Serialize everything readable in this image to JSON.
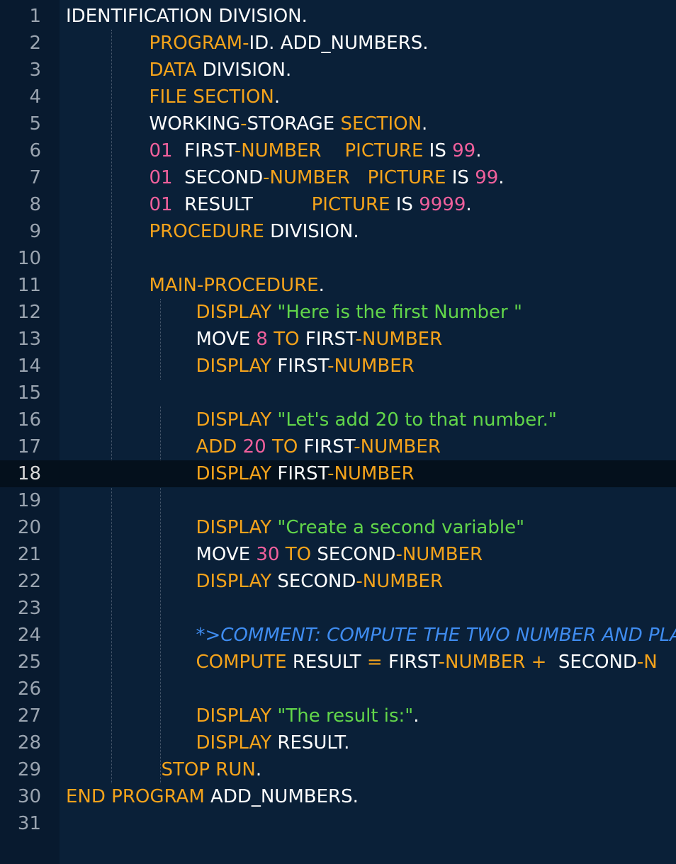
{
  "editor": {
    "language": "COBOL",
    "active_line": 18,
    "colors": {
      "background": "#0a2038",
      "gutter": "#081a2f",
      "active_line": "#04101c",
      "keyword": "#f5a31b",
      "number": "#f0609c",
      "string": "#62d64a",
      "comment": "#3f8cf0",
      "text": "#ffffff",
      "line_number": "#9aa4b0"
    },
    "lines": [
      {
        "n": "1",
        "indent": 0,
        "tokens": [
          {
            "t": "IDENTIFICATION DIVISION.",
            "c": "txt"
          }
        ]
      },
      {
        "n": "2",
        "indent": 1,
        "tokens": [
          {
            "t": "PROGRAM",
            "c": "kw"
          },
          {
            "t": "-",
            "c": "kw"
          },
          {
            "t": "ID. ADD_NUMBERS.",
            "c": "txt"
          }
        ]
      },
      {
        "n": "3",
        "indent": 1,
        "tokens": [
          {
            "t": "DATA",
            "c": "kw"
          },
          {
            "t": " DIVISION.",
            "c": "txt"
          }
        ]
      },
      {
        "n": "4",
        "indent": 1,
        "tokens": [
          {
            "t": "FILE",
            "c": "kw"
          },
          {
            "t": " ",
            "c": "txt"
          },
          {
            "t": "SECTION",
            "c": "kw"
          },
          {
            "t": ".",
            "c": "txt"
          }
        ]
      },
      {
        "n": "5",
        "indent": 1,
        "tokens": [
          {
            "t": "WORKING",
            "c": "txt"
          },
          {
            "t": "-",
            "c": "kw"
          },
          {
            "t": "STORAGE ",
            "c": "txt"
          },
          {
            "t": "SECTION",
            "c": "kw"
          },
          {
            "t": ".",
            "c": "txt"
          }
        ]
      },
      {
        "n": "6",
        "indent": 1,
        "tokens": [
          {
            "t": "01",
            "c": "num"
          },
          {
            "t": "  FIRST",
            "c": "txt"
          },
          {
            "t": "-NUMBER",
            "c": "kw"
          },
          {
            "t": "    ",
            "c": "txt"
          },
          {
            "t": "PICTURE",
            "c": "kw"
          },
          {
            "t": " IS ",
            "c": "txt"
          },
          {
            "t": "99",
            "c": "num"
          },
          {
            "t": ".",
            "c": "txt"
          }
        ]
      },
      {
        "n": "7",
        "indent": 1,
        "tokens": [
          {
            "t": "01",
            "c": "num"
          },
          {
            "t": "  SECOND",
            "c": "txt"
          },
          {
            "t": "-NUMBER",
            "c": "kw"
          },
          {
            "t": "   ",
            "c": "txt"
          },
          {
            "t": "PICTURE",
            "c": "kw"
          },
          {
            "t": " IS ",
            "c": "txt"
          },
          {
            "t": "99",
            "c": "num"
          },
          {
            "t": ".",
            "c": "txt"
          }
        ]
      },
      {
        "n": "8",
        "indent": 1,
        "tokens": [
          {
            "t": "01",
            "c": "num"
          },
          {
            "t": "  RESULT          ",
            "c": "txt"
          },
          {
            "t": "PICTURE",
            "c": "kw"
          },
          {
            "t": " IS ",
            "c": "txt"
          },
          {
            "t": "9999",
            "c": "num"
          },
          {
            "t": ".",
            "c": "txt"
          }
        ]
      },
      {
        "n": "9",
        "indent": 1,
        "tokens": [
          {
            "t": "PROCEDURE",
            "c": "kw"
          },
          {
            "t": " DIVISION.",
            "c": "txt"
          }
        ]
      },
      {
        "n": "10",
        "indent": 1,
        "tokens": []
      },
      {
        "n": "11",
        "indent": 1,
        "tokens": [
          {
            "t": "MAIN",
            "c": "kw"
          },
          {
            "t": "-",
            "c": "kw"
          },
          {
            "t": "PROCEDURE",
            "c": "kw"
          },
          {
            "t": ".",
            "c": "txt"
          }
        ]
      },
      {
        "n": "12",
        "indent": 2,
        "tokens": [
          {
            "t": "DISPLAY",
            "c": "kw"
          },
          {
            "t": " ",
            "c": "txt"
          },
          {
            "t": "\"Here is the first Number \"",
            "c": "str"
          }
        ]
      },
      {
        "n": "13",
        "indent": 2,
        "tokens": [
          {
            "t": "MOVE ",
            "c": "txt"
          },
          {
            "t": "8",
            "c": "num"
          },
          {
            "t": " ",
            "c": "txt"
          },
          {
            "t": "TO",
            "c": "kw"
          },
          {
            "t": " FIRST",
            "c": "txt"
          },
          {
            "t": "-NUMBER",
            "c": "kw"
          }
        ]
      },
      {
        "n": "14",
        "indent": 2,
        "tokens": [
          {
            "t": "DISPLAY",
            "c": "kw"
          },
          {
            "t": " FIRST",
            "c": "txt"
          },
          {
            "t": "-NUMBER",
            "c": "kw"
          }
        ]
      },
      {
        "n": "15",
        "indent": 2,
        "tokens": []
      },
      {
        "n": "16",
        "indent": 2,
        "tokens": [
          {
            "t": "DISPLAY",
            "c": "kw"
          },
          {
            "t": " ",
            "c": "txt"
          },
          {
            "t": "\"Let's add 20 to that number.\"",
            "c": "str"
          }
        ]
      },
      {
        "n": "17",
        "indent": 2,
        "tokens": [
          {
            "t": "ADD",
            "c": "kw"
          },
          {
            "t": " ",
            "c": "txt"
          },
          {
            "t": "20",
            "c": "num"
          },
          {
            "t": " ",
            "c": "txt"
          },
          {
            "t": "TO",
            "c": "kw"
          },
          {
            "t": " FIRST",
            "c": "txt"
          },
          {
            "t": "-NUMBER",
            "c": "kw"
          }
        ]
      },
      {
        "n": "18",
        "indent": 2,
        "tokens": [
          {
            "t": "DISPLAY",
            "c": "kw"
          },
          {
            "t": " FIRST",
            "c": "txt"
          },
          {
            "t": "-NUMBER",
            "c": "kw"
          }
        ]
      },
      {
        "n": "19",
        "indent": 2,
        "tokens": []
      },
      {
        "n": "20",
        "indent": 2,
        "tokens": [
          {
            "t": "DISPLAY",
            "c": "kw"
          },
          {
            "t": " ",
            "c": "txt"
          },
          {
            "t": "\"Create a second variable\"",
            "c": "str"
          }
        ]
      },
      {
        "n": "21",
        "indent": 2,
        "tokens": [
          {
            "t": "MOVE ",
            "c": "txt"
          },
          {
            "t": "30",
            "c": "num"
          },
          {
            "t": " ",
            "c": "txt"
          },
          {
            "t": "TO",
            "c": "kw"
          },
          {
            "t": " SECOND",
            "c": "txt"
          },
          {
            "t": "-NUMBER",
            "c": "kw"
          }
        ]
      },
      {
        "n": "22",
        "indent": 2,
        "tokens": [
          {
            "t": "DISPLAY",
            "c": "kw"
          },
          {
            "t": " SECOND",
            "c": "txt"
          },
          {
            "t": "-NUMBER",
            "c": "kw"
          }
        ]
      },
      {
        "n": "23",
        "indent": 2,
        "tokens": []
      },
      {
        "n": "24",
        "indent": 2,
        "tokens": [
          {
            "t": "*>COMMENT: COMPUTE THE TWO NUMBER AND PLA",
            "c": "cmt"
          }
        ]
      },
      {
        "n": "25",
        "indent": 2,
        "tokens": [
          {
            "t": "COMPUTE",
            "c": "kw"
          },
          {
            "t": " RESULT ",
            "c": "txt"
          },
          {
            "t": "=",
            "c": "kw"
          },
          {
            "t": " FIRST",
            "c": "txt"
          },
          {
            "t": "-NUMBER",
            "c": "kw"
          },
          {
            "t": " ",
            "c": "txt"
          },
          {
            "t": "+",
            "c": "kw"
          },
          {
            "t": "  SECOND",
            "c": "txt"
          },
          {
            "t": "-N",
            "c": "kw"
          }
        ]
      },
      {
        "n": "26",
        "indent": 2,
        "tokens": []
      },
      {
        "n": "27",
        "indent": 2,
        "tokens": [
          {
            "t": "DISPLAY",
            "c": "kw"
          },
          {
            "t": " ",
            "c": "txt"
          },
          {
            "t": "\"The result is:\"",
            "c": "str"
          },
          {
            "t": ".",
            "c": "txt"
          }
        ]
      },
      {
        "n": "28",
        "indent": 2,
        "tokens": [
          {
            "t": "DISPLAY",
            "c": "kw"
          },
          {
            "t": " RESULT.",
            "c": "txt"
          }
        ]
      },
      {
        "n": "29",
        "indent": 1.25,
        "tokens": [
          {
            "t": "STOP",
            "c": "kw"
          },
          {
            "t": " ",
            "c": "txt"
          },
          {
            "t": "RUN",
            "c": "kw"
          },
          {
            "t": ".",
            "c": "txt"
          }
        ]
      },
      {
        "n": "30",
        "indent": 0,
        "tokens": [
          {
            "t": "END",
            "c": "kw"
          },
          {
            "t": " ",
            "c": "txt"
          },
          {
            "t": "PROGRAM",
            "c": "kw"
          },
          {
            "t": " ADD_NUMBERS.",
            "c": "txt"
          }
        ]
      },
      {
        "n": "31",
        "indent": 0,
        "tokens": []
      }
    ]
  }
}
